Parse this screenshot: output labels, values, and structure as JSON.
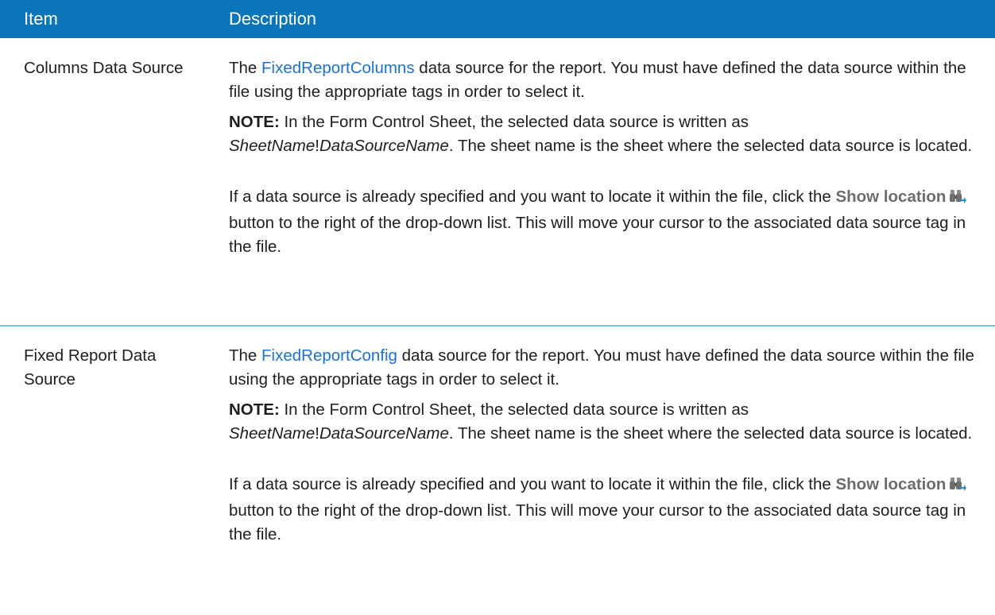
{
  "header": {
    "item": "Item",
    "description": "Description"
  },
  "rows": [
    {
      "item": "Columns Data Source",
      "p1_before": "The ",
      "p1_link": "FixedReportColumns",
      "p1_after": " data source for the report. You must have defined the data source within the file using the appropriate tags in order to select it.",
      "note_label": "NOTE:",
      "note_text": " In the Form Control Sheet, the selected data source is written as ",
      "note_sheet": "SheetName",
      "note_bang": "!",
      "note_ds": "DataSourceName",
      "note_after": ". The sheet name is the sheet where the selected data source is located.",
      "p3_before": "If a data source is already specified and you want to locate it within the file, click the ",
      "p3_button": "Show location",
      "p3_after": " button to the right of the drop-down list. This will move your cursor to the associated data source tag in the file.",
      "icon": "binoculars-icon"
    },
    {
      "item": "Fixed Report Data Source",
      "p1_before": "The ",
      "p1_link": "FixedReportConfig",
      "p1_after": " data source for the report. You must have defined the data source within the file using the appropriate tags in order to select it.",
      "note_label": "NOTE:",
      "note_text": " In the Form Control Sheet, the selected data source is written as ",
      "note_sheet": "SheetName",
      "note_bang": "!",
      "note_ds": "DataSourceName",
      "note_after": ". The sheet name is the sheet where the selected data source is located.",
      "p3_before": "If a data source is already specified and you want to locate it within the file, click the ",
      "p3_button": "Show location",
      "p3_after": " button to the right of the drop-down list. This will move your cursor to the associated data source tag in the file.",
      "icon": "binoculars-icon"
    }
  ],
  "colors": {
    "header_bg": "#0b75b9",
    "link": "#1a73d1",
    "divider": "#7cc4e6"
  }
}
